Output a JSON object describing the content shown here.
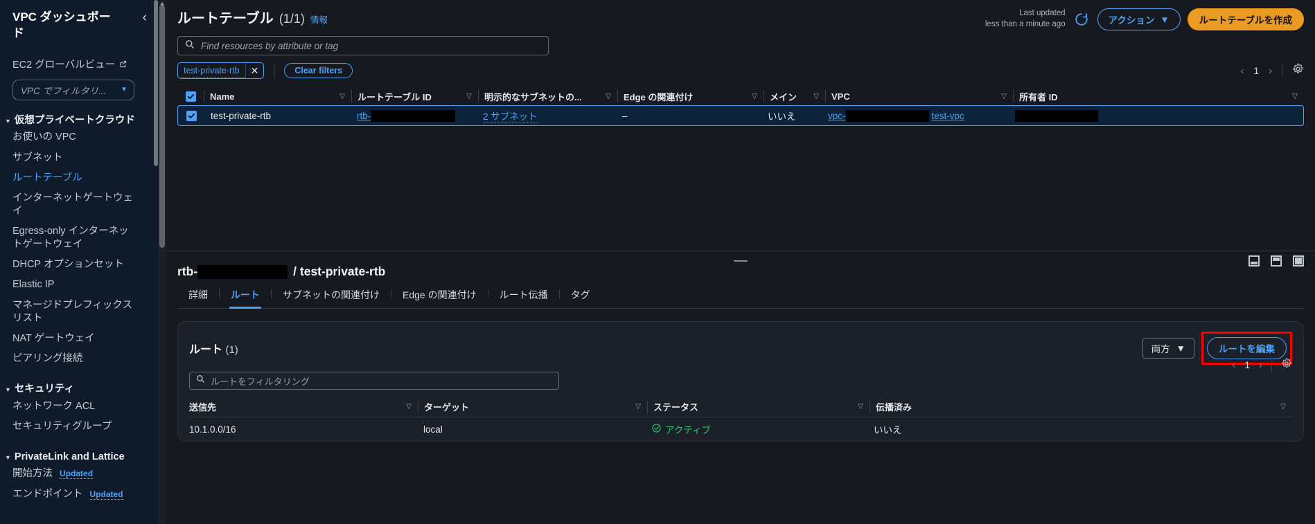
{
  "sidebar": {
    "title": "VPC ダッシュボード",
    "collapse_icon": "chevron-left-icon",
    "global_view": "EC2 グローバルビュー",
    "filter_placeholder": "VPC でフィルタリ...",
    "groups": [
      {
        "label": "仮想プライベートクラウド",
        "items": [
          {
            "label": "お使いの VPC",
            "active": false
          },
          {
            "label": "サブネット",
            "active": false
          },
          {
            "label": "ルートテーブル",
            "active": true
          },
          {
            "label": "インターネットゲートウェイ",
            "active": false
          },
          {
            "label": "Egress-only インターネットゲートウェイ",
            "active": false
          },
          {
            "label": "DHCP オプションセット",
            "active": false
          },
          {
            "label": "Elastic IP",
            "active": false
          },
          {
            "label": "マネージドプレフィックスリスト",
            "active": false
          },
          {
            "label": "NAT ゲートウェイ",
            "active": false
          },
          {
            "label": "ピアリング接続",
            "active": false
          }
        ]
      },
      {
        "label": "セキュリティ",
        "items": [
          {
            "label": "ネットワーク ACL",
            "active": false
          },
          {
            "label": "セキュリティグループ",
            "active": false
          }
        ]
      },
      {
        "label": "PrivateLink and Lattice",
        "items": [
          {
            "label": "開始方法",
            "badge": "Updated",
            "active": false
          },
          {
            "label": "エンドポイント",
            "badge": "Updated",
            "active": false
          }
        ]
      }
    ]
  },
  "header": {
    "title": "ルートテーブル",
    "count": "(1/1)",
    "info": "情報",
    "last_updated_label": "Last updated",
    "last_updated_value": "less than a minute ago",
    "refresh_icon": "refresh-icon",
    "actions_label": "アクション",
    "create_label": "ルートテーブルを作成"
  },
  "search": {
    "placeholder": "Find resources by attribute or tag",
    "icon": "search-icon"
  },
  "filters": {
    "token": "test-private-rtb",
    "token_remove_icon": "close-icon",
    "clear_label": "Clear filters",
    "page": "1",
    "prev_icon": "chevron-left-icon",
    "next_icon": "chevron-right-icon",
    "settings_icon": "gear-icon"
  },
  "resource_table": {
    "columns": [
      "Name",
      "ルートテーブル ID",
      "明示的なサブネットの...",
      "Edge の関連付け",
      "メイン",
      "VPC",
      "所有者 ID"
    ],
    "rows": [
      {
        "selected": true,
        "name": "test-private-rtb",
        "rtb_id_prefix": "rtb-",
        "rtb_id_redacted": true,
        "subnets": "2 サブネット",
        "edge": "–",
        "main": "いいえ",
        "vpc_prefix": "vpc-",
        "vpc_name": "test-vpc",
        "owner_redacted": true
      }
    ]
  },
  "splitter": {
    "panel_icons": [
      "panel-bottom-icon",
      "panel-top-icon",
      "panel-full-icon"
    ]
  },
  "detail": {
    "id_prefix": "rtb-",
    "name_suffix": "/ test-private-rtb",
    "tabs": [
      {
        "label": "詳細",
        "selected": false
      },
      {
        "label": "ルート",
        "selected": true
      },
      {
        "label": "サブネットの関連付け",
        "selected": false
      },
      {
        "label": "Edge の関連付け",
        "selected": false
      },
      {
        "label": "ルート伝播",
        "selected": false
      },
      {
        "label": "タグ",
        "selected": false
      }
    ]
  },
  "routes_card": {
    "title": "ルート",
    "count": "(1)",
    "filter_placeholder": "ルートをフィルタリング",
    "filter_icon": "search-icon",
    "select_value": "両方",
    "edit_label": "ルートを編集",
    "page": "1",
    "prev_icon": "chevron-left-icon",
    "next_icon": "chevron-right-icon",
    "settings_icon": "gear-icon",
    "columns": [
      "送信先",
      "ターゲット",
      "ステータス",
      "伝播済み"
    ],
    "rows": [
      {
        "destination": "10.1.0.0/16",
        "target": "local",
        "status": "アクティブ",
        "status_icon": "check-circle-icon",
        "propagated": "いいえ"
      }
    ]
  },
  "colors": {
    "accent_blue": "#4ea1f5",
    "primary_orange": "#ec9b22",
    "status_green": "#2bc46a",
    "highlight_red": "#ff0000"
  }
}
